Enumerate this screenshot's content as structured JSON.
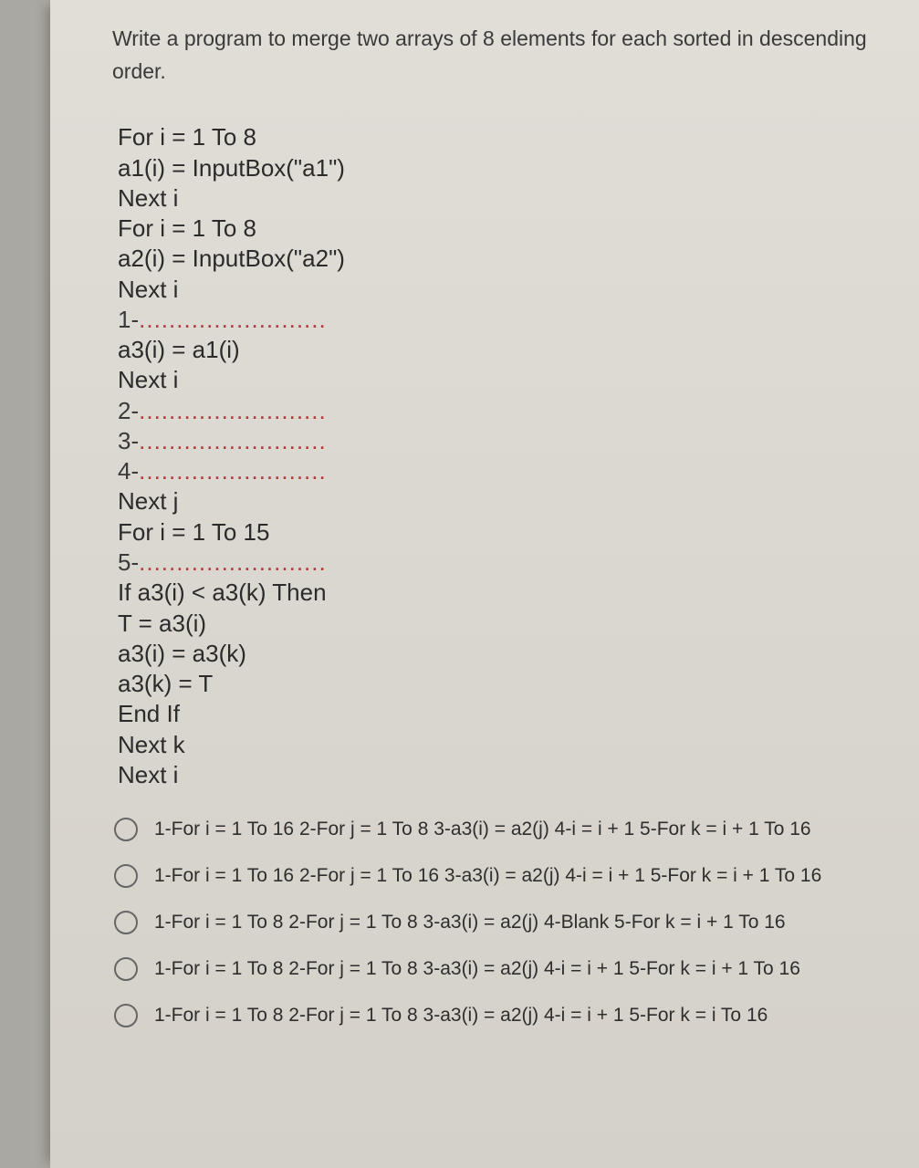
{
  "question": "Write a program to merge two arrays of 8 elements for each sorted in descending order.",
  "code": {
    "l1": "For i = 1 To 8",
    "l2": "a1(i) = InputBox(\"a1\")",
    "l3": "Next i",
    "l4": "For i = 1 To 8",
    "l5": "a2(i) = InputBox(\"a2\")",
    "l6": "Next i",
    "b1n": "1-",
    "dots": ".........................",
    "l7": "a3(i) = a1(i)",
    "l8": "Next i",
    "b2n": "2-",
    "b3n": "3-",
    "b4n": "4-",
    "l9": "Next j",
    "l10": "For i = 1 To 15",
    "b5n": "5-",
    "l11": "If a3(i) < a3(k) Then",
    "l12": "T = a3(i)",
    "l13": "a3(i) = a3(k)",
    "l14": "a3(k) = T",
    "l15": "End If",
    "l16": "Next k",
    "l17": "Next i"
  },
  "options": [
    "1-For i = 1 To 16 2-For j = 1 To 8 3-a3(i) = a2(j) 4-i = i + 1 5-For k = i + 1 To 16",
    "1-For i = 1 To 16 2-For j = 1 To 16 3-a3(i) = a2(j) 4-i = i + 1 5-For k = i + 1 To 16",
    "1-For i = 1 To 8 2-For j = 1 To 8 3-a3(i) = a2(j) 4-Blank 5-For k = i + 1 To 16",
    "1-For i = 1 To 8 2-For j = 1 To 8 3-a3(i) = a2(j) 4-i = i + 1 5-For k = i + 1 To 16",
    "1-For i = 1 To 8 2-For j = 1 To 8 3-a3(i) = a2(j) 4-i = i + 1 5-For k = i To 16"
  ]
}
